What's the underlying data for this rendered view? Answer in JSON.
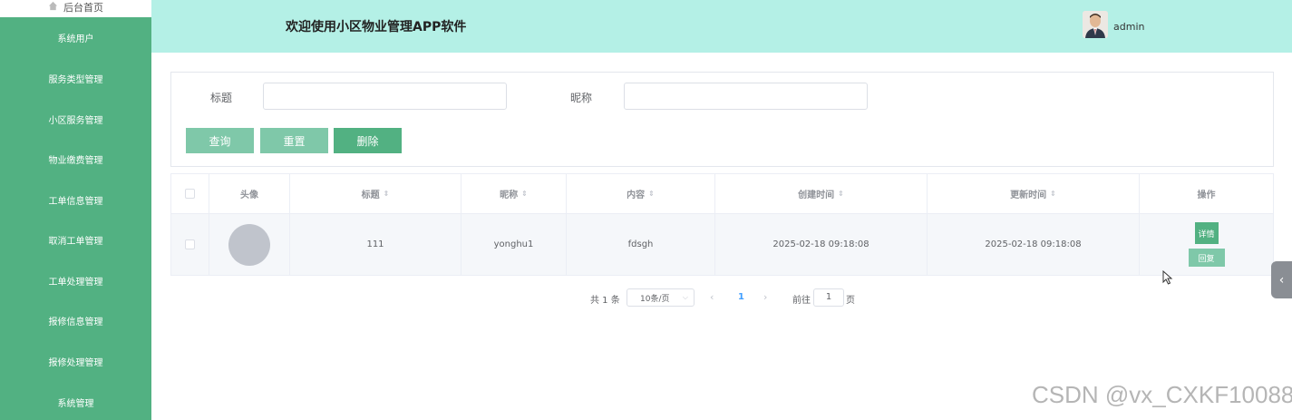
{
  "sidebar": {
    "home_label": "后台首页",
    "items": [
      {
        "label": "系统用户"
      },
      {
        "label": "服务类型管理"
      },
      {
        "label": "小区服务管理"
      },
      {
        "label": "物业缴费管理"
      },
      {
        "label": "工单信息管理"
      },
      {
        "label": "取消工单管理"
      },
      {
        "label": "工单处理管理"
      },
      {
        "label": "报修信息管理"
      },
      {
        "label": "报修处理管理"
      },
      {
        "label": "系统管理"
      }
    ]
  },
  "header": {
    "title": "欢迎使用小区物业管理APP软件",
    "username": "admin"
  },
  "search": {
    "title_label": "标题",
    "title_value": "",
    "nickname_label": "昵称",
    "nickname_value": "",
    "query_label": "查询",
    "reset_label": "重置",
    "delete_label": "删除"
  },
  "table": {
    "columns": {
      "avatar": "头像",
      "title": "标题",
      "nickname": "昵称",
      "content": "内容",
      "created": "创建时间",
      "updated": "更新时间",
      "actions": "操作"
    },
    "rows": [
      {
        "title": "111",
        "nickname": "yonghu1",
        "content": "fdsgh",
        "created": "2025-02-18 09:18:08",
        "updated": "2025-02-18 09:18:08",
        "detail_label": "详情",
        "reply_label": "回复"
      }
    ]
  },
  "pagination": {
    "total": "共 1 条",
    "page_size": "10条/页",
    "current_page": "1",
    "goto_label": "前往",
    "goto_value": "1",
    "page_suffix": "页"
  },
  "watermark": "CSDN @vx_CXKF10088",
  "colors": {
    "sidebar": "#52b182",
    "header": "#b4f0e6",
    "button_light": "#7fc8a9",
    "button_dark": "#52b182",
    "active_page": "#409eff"
  },
  "icons": {
    "home": "home-icon",
    "sort": "sort-icon",
    "chevron_down": "chevron-down-icon",
    "prev": "chevron-left-icon",
    "next": "chevron-right-icon",
    "handle": "chevron-left-icon",
    "cursor": "mouse-cursor-icon"
  }
}
